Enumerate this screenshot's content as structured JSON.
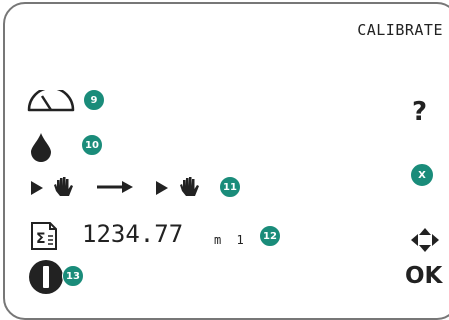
{
  "screen": {
    "title": "CALIBRATE",
    "value": "1234.77",
    "unit": "m 1",
    "help_label": "?",
    "ok_label": "OK"
  },
  "badges": {
    "gauge": "9",
    "drop": "10",
    "sequence": "11",
    "value": "12",
    "power": "13",
    "cancel": "X"
  },
  "icons": [
    "gauge-icon",
    "drop-icon",
    "play-icon",
    "hand-icon",
    "arrow-right-icon",
    "play-icon",
    "hand-icon",
    "calculator-icon",
    "power-icon",
    "navigate-icon"
  ],
  "colors": {
    "badge": "#1a8c7a",
    "text": "#222222",
    "border": "#777777"
  }
}
